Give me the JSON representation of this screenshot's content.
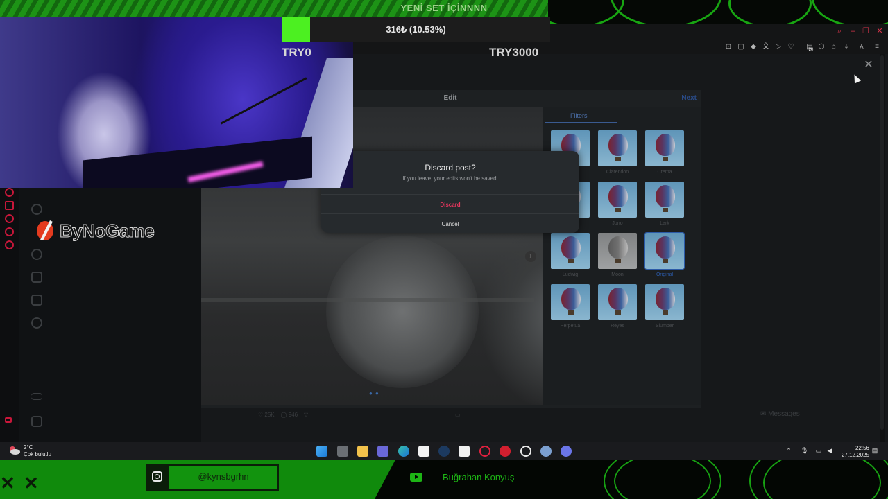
{
  "overlay": {
    "banner_text": "YENİ SET İÇİNNNN",
    "progress": {
      "amount_text": "316₺ (10.53%)",
      "fraction": 0.1053,
      "min_label": "TRY0",
      "max_label": "TRY3000",
      "fill_color": "#4cf021"
    },
    "logo_text": "ByNoGame",
    "instagram_handle": "@kynsbgrhn",
    "youtube_name": "Buğrahan Konyuş",
    "accent_color": "#1db415"
  },
  "browser": {
    "window_controls": [
      "search-icon",
      "minimize-icon",
      "restore-icon",
      "close-icon"
    ],
    "toolbar_icons": [
      "pin-icon",
      "screenshot-icon",
      "shield-icon",
      "translate-icon",
      "play-icon",
      "heart-icon",
      "extension-icon",
      "box-icon",
      "profile-icon",
      "download-icon",
      "ai-icon",
      "menu-icon"
    ],
    "toolbar_badge": "20",
    "ai_label": "AI"
  },
  "instagram": {
    "edit_title": "Edit",
    "next_label": "Next",
    "filters_tab": "Filters",
    "filters": [
      {
        "name": "",
        "style": "color"
      },
      {
        "name": "Clarendon",
        "style": "color"
      },
      {
        "name": "Crema",
        "style": "color"
      },
      {
        "name": "",
        "style": "color"
      },
      {
        "name": "Juno",
        "style": "color"
      },
      {
        "name": "Lark",
        "style": "color"
      },
      {
        "name": "Ludwig",
        "style": "color"
      },
      {
        "name": "Moon",
        "style": "gray"
      },
      {
        "name": "Original",
        "style": "color",
        "selected": true
      },
      {
        "name": "Perpetua",
        "style": "color"
      },
      {
        "name": "Reyes",
        "style": "color"
      },
      {
        "name": "Slumber",
        "style": "color"
      }
    ],
    "post_likes": "25K",
    "post_comments": "946",
    "messages_label": "Messages"
  },
  "dialog": {
    "title": "Discard post?",
    "message": "If you leave, your edits won't be saved.",
    "discard_label": "Discard",
    "cancel_label": "Cancel",
    "discard_color": "#e8365e"
  },
  "taskbar": {
    "weather_temp": "2°C",
    "weather_desc": "Çok bulutlu",
    "apps": [
      "windows-start-icon",
      "task-view-icon",
      "file-explorer-icon",
      "teams-icon",
      "edge-icon",
      "capcut-icon",
      "steam-icon",
      "store-icon",
      "opera-gx-icon",
      "media-app-icon",
      "chatgpt-icon",
      "settings-app-icon",
      "discord-icon"
    ],
    "clock_time": "22:56",
    "clock_date": "27.12.2025"
  }
}
